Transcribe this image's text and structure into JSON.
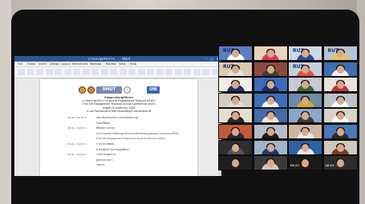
{
  "word": {
    "title": "การประชุมวิชาการ ... - Word",
    "tabs": [
      "File",
      "Home",
      "Insert",
      "Design",
      "Layout",
      "References",
      "Mailings",
      "Review",
      "View",
      "Help"
    ],
    "logo_text_1": "RMUT",
    "logo_text_2": "UNI",
    "document": {
      "title_lines": [
        "กำหนดการประชุมวิชาการ",
        "การจัดประชุมวิชาการระดับชาติ Engagement Thailand ครั้งที่ 4",
        "(The 4th Engagement Thailand Annual Conference 2020)",
        "วันพุธที่ 25 พฤศจิกายน 2563",
        "ณ มหาวิทยาลัยเทคโนโลยีราชมงคลธัญบุรี จังหวัดปทุมธานี"
      ],
      "schedule": [
        {
          "time": "08.00 - 08.30 น.",
          "item": "ลงทะเบียนรับเอกสาร และเข้าห้องประชุม"
        },
        {
          "time": "",
          "item": "รับชมวีดีทัศน์"
        },
        {
          "time": "08.30 - 09.00 น.",
          "item": "พิธีเปิดการประชุม"
        },
        {
          "time": "",
          "item": "กล่าวรายงานการจัดประชุมวิชาการระดับชาติ Engagement Thailand ครั้งที่ 4"
        },
        {
          "time": "",
          "item": "(The 4th Engagement Thailand Annual Conference 2020)"
        },
        {
          "time": "09.00 - 10.30 น.",
          "item": "การบรรยายพิเศษ"
        },
        {
          "time": "",
          "item": "หัวข้อ ผู้บริหารสถาบันอุดมศึกษา"
        },
        {
          "time": "10.30 - 12.00 น.",
          "item": "การนำเสนอผลงาน"
        },
        {
          "time": "",
          "item": "ผู้ดำเนินรายการ"
        },
        {
          "time": "",
          "item": "วิทยากร"
        }
      ]
    }
  },
  "gallery": {
    "rut_label": "RUT",
    "speaker_name": "ผศ.ดร. ...",
    "tiles": [
      {
        "bg": "#5b7fbf",
        "shirt": "#ffffff",
        "rut": true
      },
      {
        "bg": "#e9d6b8",
        "shirt": "#d83a5a",
        "rut": false
      },
      {
        "bg": "#cfd8e6",
        "shirt": "#2a4e9a",
        "rut": true
      },
      {
        "bg": "#b9c3d4",
        "shirt": "#e8c65a",
        "rut": true
      },
      {
        "bg": "#d9c9b0",
        "shirt": "#e6e0da",
        "rut": true
      },
      {
        "bg": "#8d4b3a",
        "shirt": "#3d3d3d",
        "rut": false
      },
      {
        "bg": "#c4cfe0",
        "shirt": "#e74b4b",
        "rut": true
      },
      {
        "bg": "#3e6fb0",
        "shirt": "#f0f0f0",
        "rut": false
      },
      {
        "bg": "#f1eee8",
        "shirt": "#1d2f6a",
        "rut": false
      },
      {
        "bg": "#3a6cb7",
        "shirt": "#1b2a6b",
        "rut": false
      },
      {
        "bg": "#c7cad3",
        "shirt": "#2e6b3a",
        "rut": false
      },
      {
        "bg": "#e7e2da",
        "shirt": "#b9343d",
        "rut": false
      },
      {
        "bg": "#d1ccc4",
        "shirt": "#e2dcd4",
        "rut": false
      },
      {
        "bg": "#3b70b8",
        "shirt": "#f2f2f2",
        "rut": false
      },
      {
        "bg": "#6f89a8",
        "shirt": "#d4a92b",
        "rut": false
      },
      {
        "bg": "#bcc2cc",
        "shirt": "#ffffff",
        "rut": false
      },
      {
        "bg": "#e6ddd0",
        "shirt": "#262626",
        "rut": false
      },
      {
        "bg": "#456ba8",
        "shirt": "#f0e8d0",
        "rut": false
      },
      {
        "bg": "#8aa6c8",
        "shirt": "#3a3a3a",
        "rut": false
      },
      {
        "bg": "#d8d2c8",
        "shirt": "#ffffff",
        "rut": false
      },
      {
        "bg": "#c45a3c",
        "shirt": "#2a2a2a",
        "rut": false
      },
      {
        "bg": "#b8bec8",
        "shirt": "#1a1a1a",
        "rut": false
      },
      {
        "bg": "#d0b6a0",
        "shirt": "#ececec",
        "rut": false
      },
      {
        "bg": "#4a78b8",
        "shirt": "#2a2a2a",
        "rut": false
      },
      {
        "bg": "#2f2f2f",
        "shirt": "#555555",
        "rut": false
      },
      {
        "bg": "#9fb3cc",
        "shirt": "#1f3a6a",
        "rut": false
      },
      {
        "bg": "#3060a8",
        "shirt": "#e8e8e8",
        "rut": false
      },
      {
        "bg": "#cfc8be",
        "shirt": "#7a3b2a",
        "rut": false
      },
      {
        "bg": "#1e1e1e",
        "shirt": "#1e1e1e",
        "rut": false
      },
      {
        "bg": "#3a3a3a",
        "shirt": "#d0c8b8",
        "rut": false
      },
      {
        "bg": "#1b1b1b",
        "shirt": "#1b1b1b",
        "rut": false
      },
      {
        "bg": "#2c2c2c",
        "shirt": "#2c2c2c",
        "rut": false
      }
    ]
  }
}
